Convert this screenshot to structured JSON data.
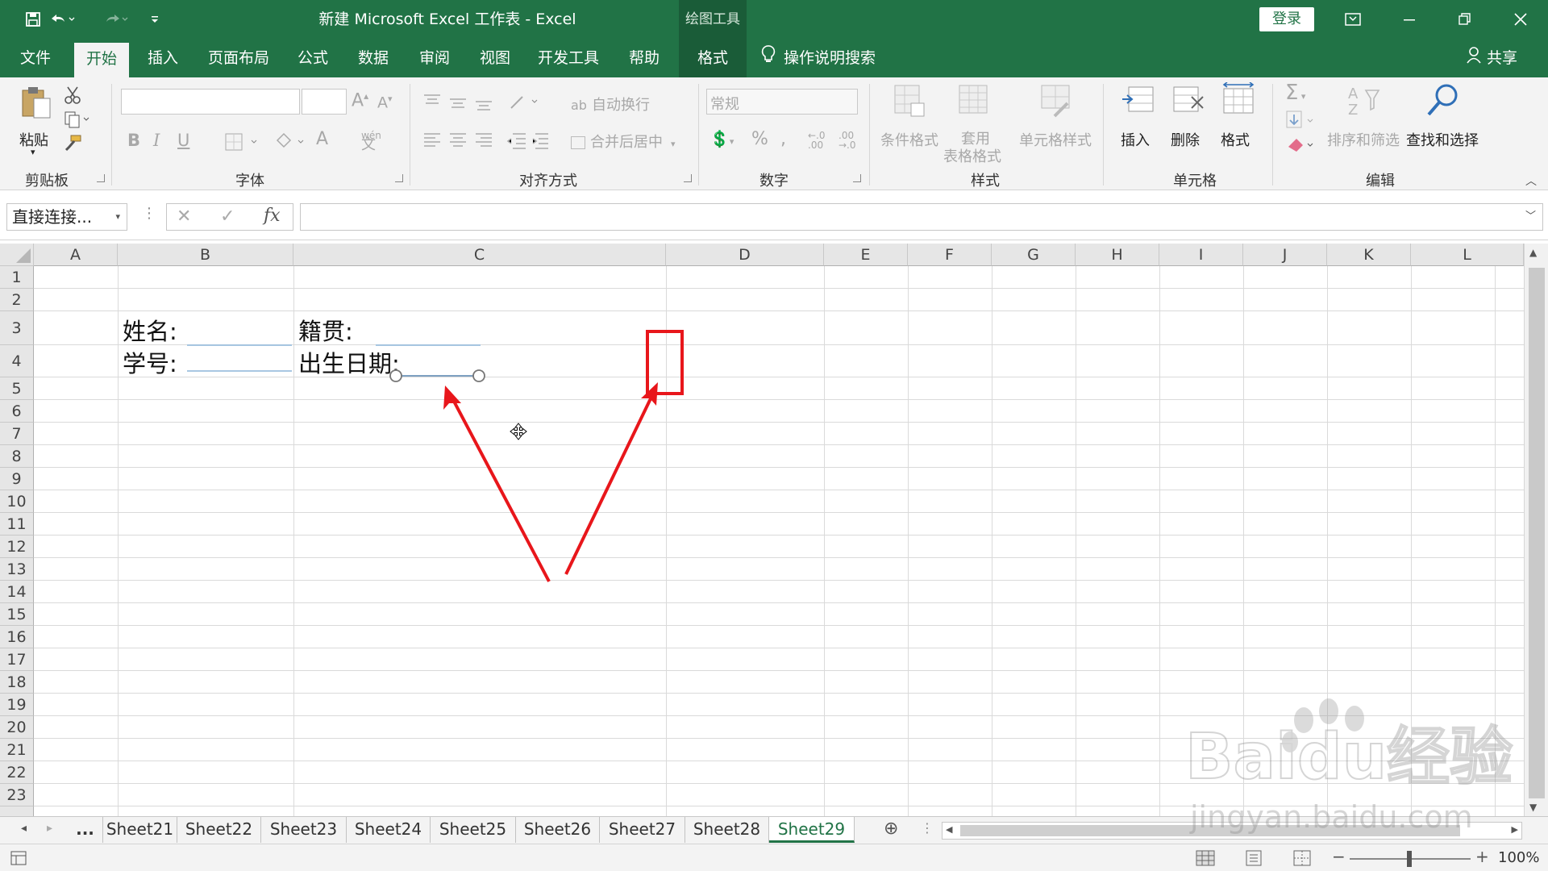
{
  "app": {
    "title": "新建 Microsoft Excel 工作表  -  Excel",
    "context_tab": "绘图工具",
    "login": "登录",
    "accent": "#217346"
  },
  "tabs": [
    {
      "label": "文件"
    },
    {
      "label": "开始",
      "active": true
    },
    {
      "label": "插入"
    },
    {
      "label": "页面布局"
    },
    {
      "label": "公式"
    },
    {
      "label": "数据"
    },
    {
      "label": "审阅"
    },
    {
      "label": "视图"
    },
    {
      "label": "开发工具"
    },
    {
      "label": "帮助"
    },
    {
      "label": "格式"
    }
  ],
  "tellme": "操作说明搜索",
  "share": "共享",
  "ribbon": {
    "clipboard": {
      "label": "剪贴板",
      "paste": "粘贴"
    },
    "font": {
      "label": "字体",
      "wen": "wén"
    },
    "alignment": {
      "label": "对齐方式",
      "wrap": "自动换行",
      "merge": "合并后居中"
    },
    "number": {
      "label": "数字",
      "format_value": "常规"
    },
    "styles": {
      "label": "样式",
      "conditional": "条件格式",
      "table_fmt_1": "套用",
      "table_fmt_2": "表格格式",
      "cell_styles": "单元格样式"
    },
    "cells": {
      "label": "单元格",
      "insert": "插入",
      "delete": "删除",
      "format": "格式"
    },
    "editing": {
      "label": "编辑",
      "sort": "排序和筛选",
      "find": "查找和选择"
    }
  },
  "formula_bar": {
    "name_box": "直接连接...",
    "fx": "fx",
    "value": ""
  },
  "columns": [
    "A",
    "B",
    "C",
    "D",
    "E",
    "F",
    "G",
    "H",
    "I",
    "J",
    "K",
    "L"
  ],
  "rows": [
    "1",
    "2",
    "3",
    "4",
    "5",
    "6",
    "7",
    "8",
    "9",
    "10",
    "11",
    "12",
    "13",
    "14",
    "15",
    "16",
    "17",
    "18",
    "19",
    "20",
    "21",
    "22",
    "23"
  ],
  "cells": {
    "b3": "姓名:",
    "b4": "学号:",
    "c3": "籍贯:",
    "c4": "出生日期:"
  },
  "sheets": {
    "ellipsis": "...",
    "tabs": [
      "Sheet21",
      "Sheet22",
      "Sheet23",
      "Sheet24",
      "Sheet25",
      "Sheet26",
      "Sheet27",
      "Sheet28",
      "Sheet29"
    ],
    "active": "Sheet29"
  },
  "status": {
    "zoom": "100%"
  },
  "annotation_color": "#e8161b",
  "watermark": {
    "brand": "Baidu经验",
    "url": "jingyan.baidu.com"
  }
}
